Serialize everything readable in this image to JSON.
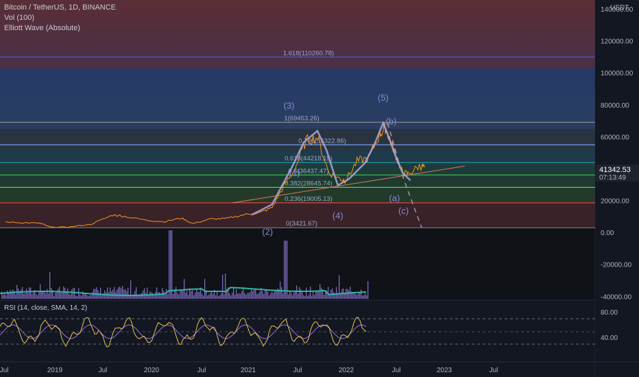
{
  "header": {
    "symbol": "Bitcoin / TetherUS, 1D, BINANCE",
    "vol_label": "Vol (100)",
    "indicator_label": "Elliott Wave (Absolute)",
    "currency": "USDT",
    "last_price": "41342.53",
    "countdown": "07:13:49"
  },
  "rsi": {
    "label": "RSI (14, close, SMA, 14, 2)",
    "ticks": [
      "80.00",
      "40.00"
    ]
  },
  "colors": {
    "background": "#131722",
    "price_line": "#f7941d",
    "wave_line": "#b0a8d8",
    "rsi_line": "#e8c84f",
    "rsi_ma": "#9b6fe8",
    "volume": "#8e7bdc",
    "volume_ma": "#2fb7a6"
  },
  "chart_data": {
    "type": "line",
    "x_ticks": [
      "Jul",
      "2019",
      "Jul",
      "2020",
      "Jul",
      "2021",
      "Jul",
      "2022",
      "Jul",
      "2023",
      "Jul"
    ],
    "y_ticks": [
      "140000.00",
      "120000.00",
      "100000.00",
      "80000.00",
      "60000.00",
      "40000.00",
      "20000.00",
      "0.00",
      "-20000.00",
      "-40000.00"
    ],
    "ylim": [
      -42000,
      146000
    ],
    "fib_levels": [
      {
        "label": "1.618(110260.78)",
        "value": 110260.78,
        "color": "#3f5bd9"
      },
      {
        "label": "1(69453.26)",
        "value": 69453.26,
        "color": "#8a8a8a"
      },
      {
        "label": "0.786(55322.86)",
        "value": 55322.86,
        "color": "#6fa3f5"
      },
      {
        "label": "0.618(44218.19)",
        "value": 44218.19,
        "color": "#1f9e93"
      },
      {
        "label": "0.5(36437.47)",
        "value": 36437.47,
        "color": "#3fb951"
      },
      {
        "label": "0.382(28645.74)",
        "value": 28645.74,
        "color": "#6ec15e"
      },
      {
        "label": "0.236(19005.13)",
        "value": 19005.13,
        "color": "#e0443e"
      },
      {
        "label": "0(3421.67)",
        "value": 3421.67,
        "color": "#8a8a8a"
      }
    ],
    "wave_labels": [
      {
        "label": "(1)",
        "date": "2021.1",
        "value": 36000
      },
      {
        "label": "(2)",
        "date": "2020.86",
        "value": -1000
      },
      {
        "label": "(3)",
        "date": "2021.05",
        "value": 78000
      },
      {
        "label": "(4)",
        "date": "2021.48",
        "value": 9000
      },
      {
        "label": "(5)",
        "date": "2021.88",
        "value": 83000
      },
      {
        "label": "(b)",
        "date": "2021.95",
        "value": 68000
      },
      {
        "label": "(a)",
        "date": "2021.98",
        "value": 20000
      },
      {
        "label": "(c)",
        "date": "2022.06",
        "value": 12000
      }
    ],
    "price_series": {
      "x": [
        2018.55,
        2018.7,
        2018.85,
        2018.95,
        2019.1,
        2019.3,
        2019.5,
        2019.6,
        2019.8,
        2019.95,
        2020.1,
        2020.2,
        2020.35,
        2020.5,
        2020.65,
        2020.8,
        2020.9,
        2021.0,
        2021.1,
        2021.2,
        2021.3,
        2021.4,
        2021.5,
        2021.55,
        2021.65,
        2021.75,
        2021.85,
        2021.9,
        2021.95,
        2022.0,
        2022.05,
        2022.1,
        2022.2,
        2022.25
      ],
      "y": [
        7000,
        6500,
        6300,
        3700,
        3800,
        5500,
        11500,
        10500,
        8000,
        7200,
        9500,
        6000,
        8800,
        9200,
        11500,
        13000,
        16000,
        29000,
        40000,
        58000,
        60000,
        38000,
        34000,
        33000,
        45000,
        47000,
        62000,
        66000,
        57000,
        47000,
        38000,
        37000,
        42000,
        41342
      ]
    },
    "wave_path": {
      "x": [
        2020.72,
        2020.9,
        2021.08,
        2021.18,
        2021.3,
        2021.38,
        2021.48,
        2021.58,
        2021.72,
        2021.8,
        2021.88,
        2021.92,
        2021.98,
        2022.05,
        2022.12
      ],
      "y": [
        11500,
        18000,
        42000,
        57000,
        64000,
        52000,
        30000,
        34000,
        44000,
        55000,
        69000,
        62000,
        50000,
        38000,
        33000
      ]
    },
    "projection": {
      "x": [
        2021.92,
        2022.06,
        2022.22
      ],
      "y": [
        69000,
        34000,
        3421
      ]
    },
    "trendline": {
      "x": [
        2020.55,
        2022.6
      ],
      "y": [
        19000,
        42000
      ]
    },
    "last_value": 41342.53
  }
}
